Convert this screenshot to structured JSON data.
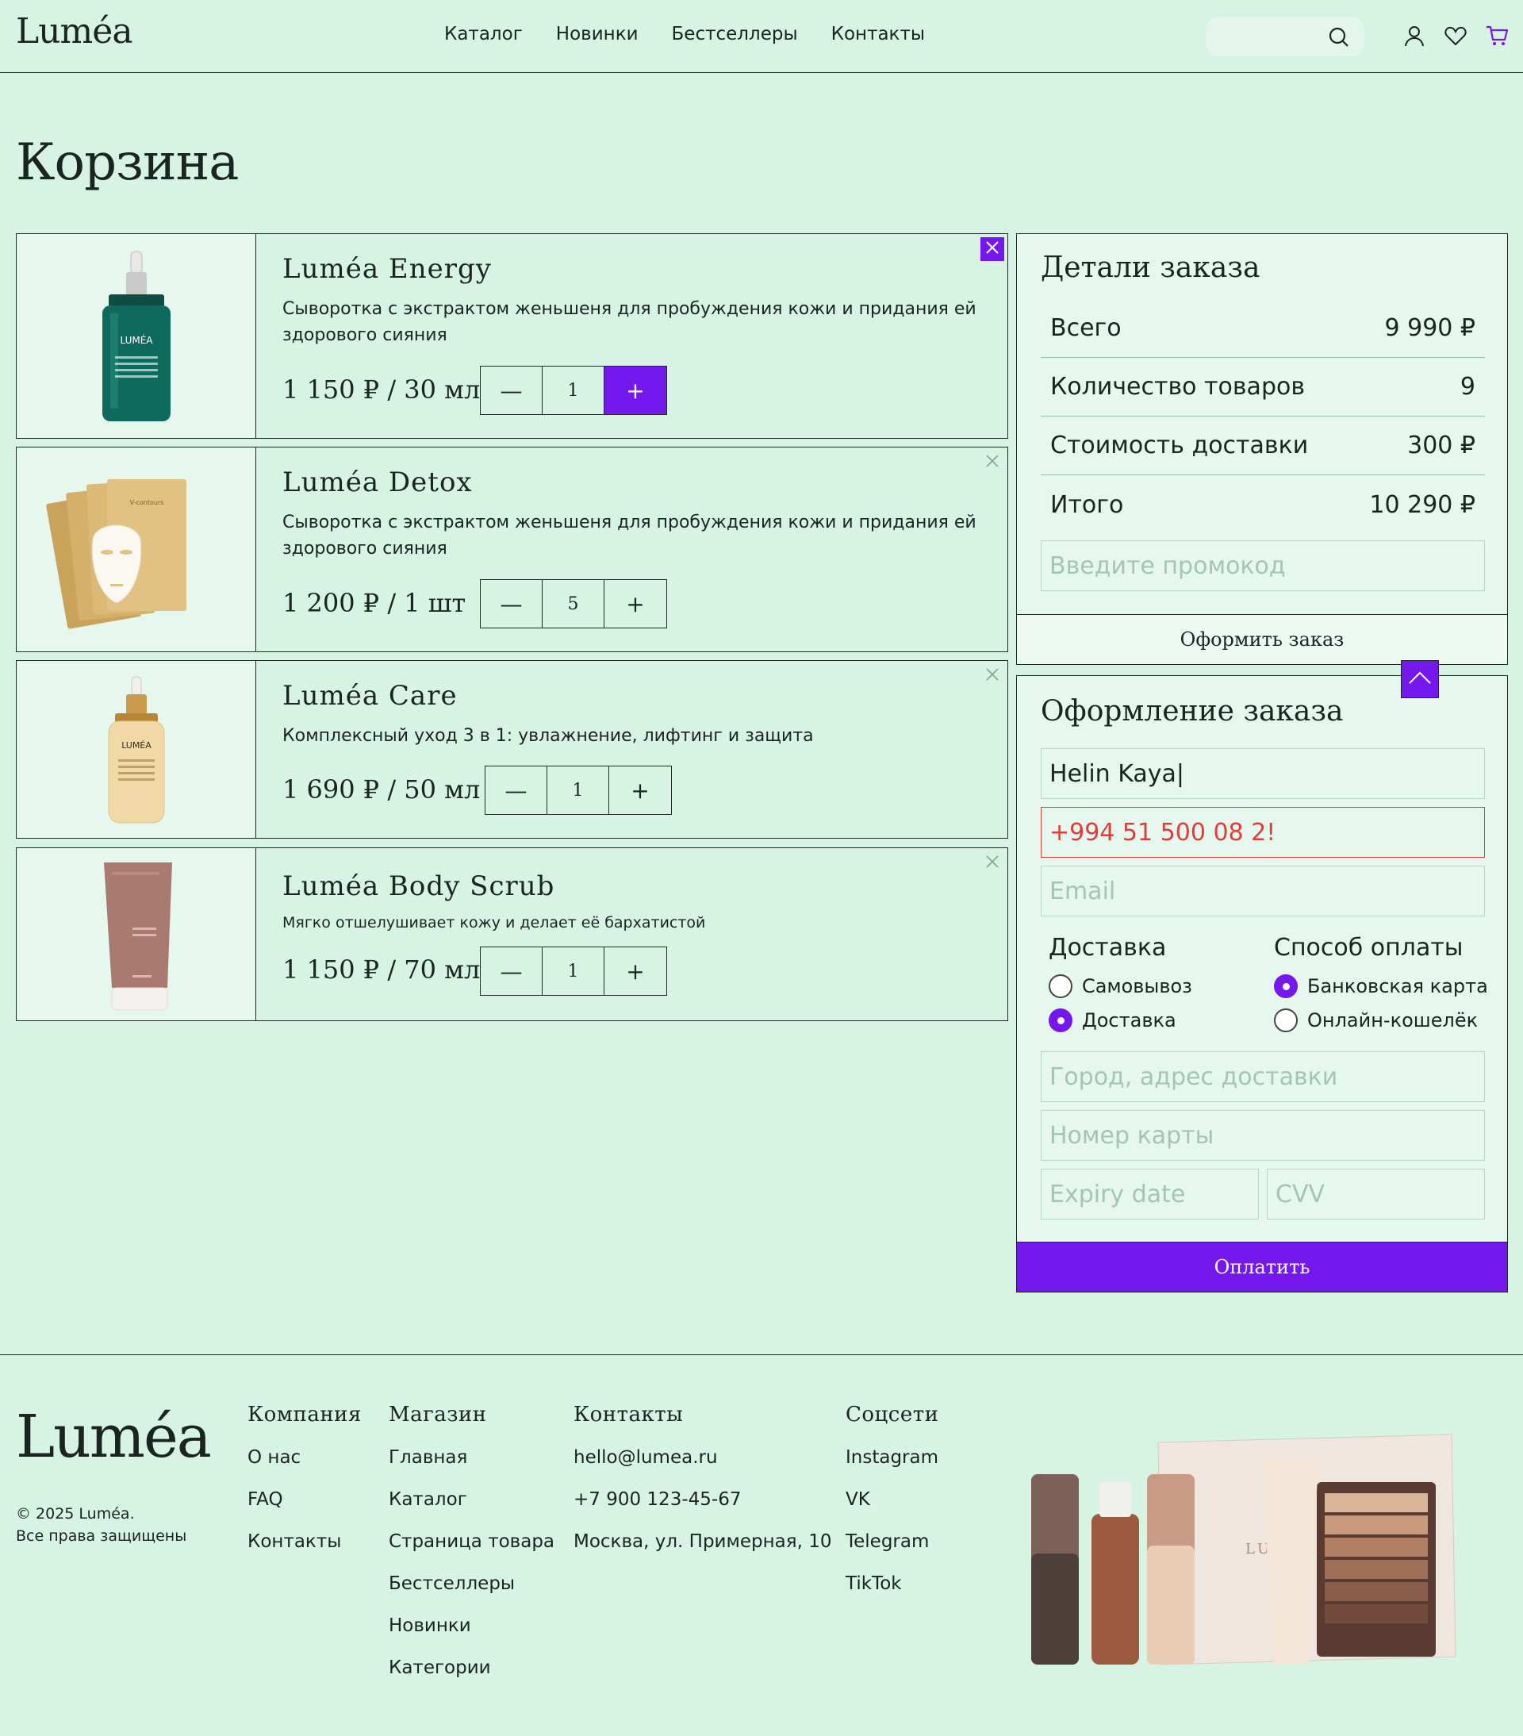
{
  "brand": {
    "name": "Luméa",
    "accent": "#7518ee",
    "error": "#e23b3b"
  },
  "nav": [
    "Каталог",
    "Новинки",
    "Бестселлеры",
    "Контакты"
  ],
  "header_icons": [
    "search-icon",
    "user-icon",
    "heart-icon",
    "cart-icon"
  ],
  "page": {
    "title": "Корзина"
  },
  "cart": [
    {
      "name": "Luméa Energy",
      "desc": "Сыворотка с экстрактом женьшеня для пробуждения кожи и придания ей здорового сияния",
      "price": "1 150 ₽ / 30 мл",
      "qty": "1",
      "minus": "—",
      "plus": "+"
    },
    {
      "name": "Luméa Detox",
      "desc": "Сыворотка с экстрактом женьшеня для пробуждения кожи и придания ей здорового сияния",
      "price": "1 200 ₽ / 1 шт",
      "qty": "5",
      "minus": "—",
      "plus": "+"
    },
    {
      "name": "Luméa Care",
      "desc": "Комплексный уход 3 в 1: увлажнение, лифтинг и защита",
      "price": "1 690 ₽ / 50 мл",
      "qty": "1",
      "minus": "—",
      "plus": "+"
    },
    {
      "name": "Luméa Body Scrub",
      "desc": "Мягко отшелушивает кожу и делает её бархатистой",
      "price": "1 150 ₽ / 70 мл",
      "qty": "1",
      "minus": "—",
      "plus": "+"
    }
  ],
  "summary": {
    "title": "Детали заказа",
    "rows": [
      {
        "label": "Всего",
        "value": "9 990 ₽"
      },
      {
        "label": "Количество товаров",
        "value": "9"
      },
      {
        "label": "Стоимость доставки",
        "value": "300 ₽"
      },
      {
        "label": "Итого",
        "value": "10 290 ₽"
      }
    ],
    "promo_placeholder": "Введите промокод",
    "submit": "Оформить заказ"
  },
  "checkout": {
    "title": "Оформление заказа",
    "name_value": "Helin Kaya|",
    "phone_value": "+994 51 500 08 2!",
    "email_placeholder": "Email",
    "delivery": {
      "title": "Доставка",
      "options": [
        "Самовывоз",
        "Доставка"
      ],
      "selected": 1
    },
    "payment": {
      "title": "Способ оплаты",
      "options": [
        "Банковская карта",
        "Онлайн-кошелёк"
      ],
      "selected": 0
    },
    "address_placeholder": "Город, адрес доставки",
    "card_placeholder": "Номер карты",
    "expiry_placeholder": "Expiry date",
    "cvv_placeholder": "CVV",
    "pay": "Оплатить"
  },
  "footer": {
    "logo": "Luméa",
    "copyright": "© 2025 Luméa.",
    "rights": "Все права защищены",
    "columns": [
      {
        "title": "Компания",
        "links": [
          "О нас",
          "FAQ",
          "Контакты"
        ]
      },
      {
        "title": "Магазин",
        "links": [
          "Главная",
          "Каталог",
          "Страница товара",
          "Бестселлеры",
          "Новинки",
          "Категории"
        ]
      },
      {
        "title": "Контакты",
        "links": [
          "hello@lumea.ru",
          "+7 900 123-45-67",
          "Москва, ул. Примерная, 10"
        ]
      },
      {
        "title": "Соцсети",
        "links": [
          "Instagram",
          "VK",
          "Telegram",
          "TikTok"
        ]
      }
    ],
    "box_brand": "LUMÉA"
  }
}
